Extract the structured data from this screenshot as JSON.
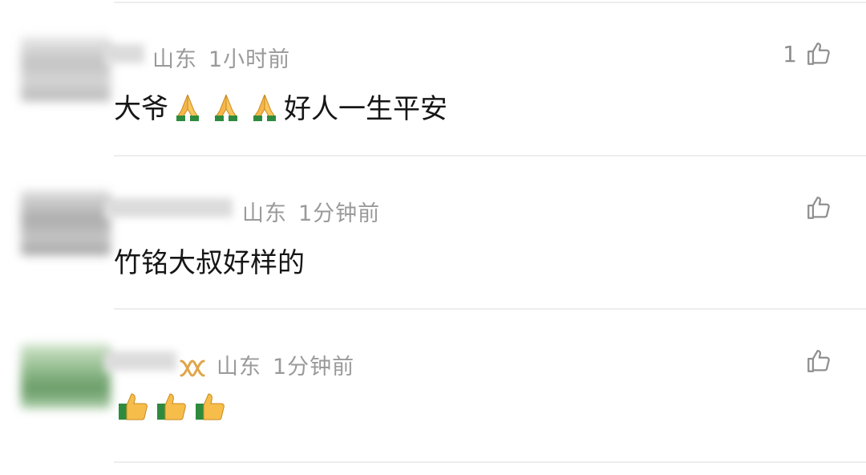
{
  "comments": [
    {
      "location": "山东",
      "time": "1小时前",
      "text_before": "大爷",
      "text_after": "好人一生平安",
      "emoji": "folded-hands-icon",
      "like_count": "1",
      "avatar_colors": [
        "#d9d9d9",
        "#bdbdbd",
        "#9c9c9c"
      ]
    },
    {
      "location": "山东",
      "time": "1分钟前",
      "text": "竹铭大叔好样的",
      "like_count": "",
      "avatar_colors": [
        "#c2c2c2",
        "#a7a7a7",
        "#7f7f7f"
      ]
    },
    {
      "location": "山东",
      "time": "1分钟前",
      "text": "",
      "emoji": "thumbs-up-icon",
      "badge": "vip-badge-icon",
      "like_count": "",
      "avatar_colors": [
        "#b7d6b1",
        "#6fa36b",
        "#3d7a3b"
      ]
    }
  ],
  "colors": {
    "meta_text": "#9a9a9a",
    "body_text": "#161616",
    "divider": "#ededed",
    "badge": "#e0a54a"
  }
}
